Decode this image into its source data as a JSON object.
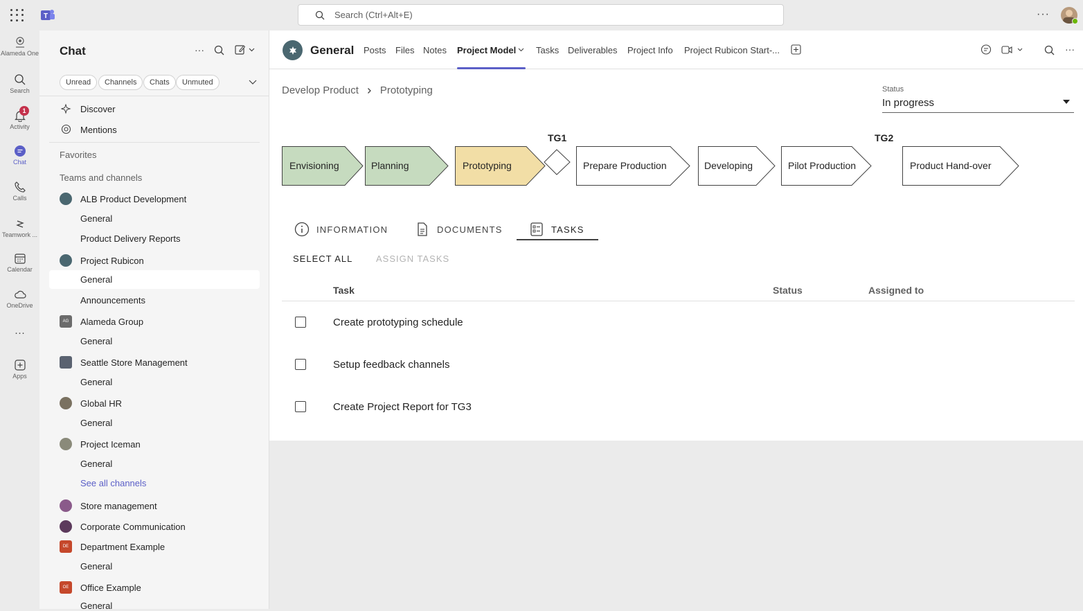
{
  "topbar": {
    "search_placeholder": "Search (Ctrl+Alt+E)",
    "more": "···"
  },
  "rail": [
    {
      "label": "Alameda One",
      "icon": "org-icon"
    },
    {
      "label": "Search",
      "icon": "search-icon"
    },
    {
      "label": "Activity",
      "icon": "bell-icon",
      "badge": "1"
    },
    {
      "label": "Chat",
      "icon": "chat-icon",
      "active": true
    },
    {
      "label": "Calls",
      "icon": "phone-icon"
    },
    {
      "label": "Teamwork ...",
      "icon": "teamwork-icon"
    },
    {
      "label": "Calendar",
      "icon": "calendar-icon"
    },
    {
      "label": "OneDrive",
      "icon": "cloud-icon"
    },
    {
      "label": "···",
      "icon": "more-icon"
    },
    {
      "label": "Apps",
      "icon": "apps-icon"
    }
  ],
  "sidebar": {
    "title": "Chat",
    "filters": [
      "Unread",
      "Channels",
      "Chats",
      "Unmuted"
    ],
    "discover": "Discover",
    "mentions": "Mentions",
    "favorites": "Favorites",
    "teams_heading": "Teams and channels",
    "teams": [
      {
        "name": "ALB Product Development",
        "channels": [
          "General",
          "Product Delivery Reports"
        ],
        "color": "#4a6770"
      },
      {
        "name": "Project Rubicon",
        "channels": [
          "General",
          "Announcements"
        ],
        "color": "#4a6770"
      },
      {
        "name": "Alameda Group",
        "channels": [
          "General"
        ],
        "color": "#6b6b6b",
        "initials": "AG"
      },
      {
        "name": "Seattle Store Management",
        "channels": [
          "General"
        ],
        "color": "#5a6270"
      },
      {
        "name": "Global HR",
        "channels": [
          "General"
        ],
        "color": "#7a7160"
      },
      {
        "name": "Project Iceman",
        "channels": [
          "General"
        ],
        "color": "#8a8a7a"
      }
    ],
    "see_all": "See all channels",
    "more_teams": [
      {
        "name": "Store management",
        "color": "#8a5a8a"
      },
      {
        "name": "Corporate Communication",
        "color": "#5c3a5c"
      },
      {
        "name": "Department Example",
        "color": "#c5482b",
        "initials": "DE",
        "channel": "General"
      },
      {
        "name": "Office Example",
        "color": "#c5482b",
        "initials": "OE",
        "channel": "General"
      }
    ]
  },
  "header": {
    "channel": "General",
    "tabs": [
      "Posts",
      "Files",
      "Notes",
      "Project Model",
      "Tasks",
      "Deliverables",
      "Project Info",
      "Project Rubicon Start-..."
    ],
    "active_tab": "Project Model"
  },
  "content": {
    "breadcrumb": [
      "Develop Product",
      "Prototyping"
    ],
    "status_label": "Status",
    "status_value": "In progress",
    "gates": [
      "TG1",
      "TG2"
    ],
    "phases": [
      {
        "label": "Envisioning",
        "state": "done",
        "color": "#c6dbbf"
      },
      {
        "label": "Planning",
        "state": "done",
        "color": "#c6dbbf"
      },
      {
        "label": "Prototyping",
        "state": "current",
        "color": "#f2dea6"
      },
      {
        "label": "Prepare Production",
        "state": "future",
        "color": "#ffffff"
      },
      {
        "label": "Developing",
        "state": "future",
        "color": "#ffffff"
      },
      {
        "label": "Pilot Production",
        "state": "future",
        "color": "#ffffff"
      },
      {
        "label": "Product Hand-over",
        "state": "future",
        "color": "#ffffff"
      }
    ],
    "panel_tabs": [
      "INFORMATION",
      "DOCUMENTS",
      "TASKS"
    ],
    "active_panel_tab": "TASKS",
    "select_all": "SELECT ALL",
    "assign_tasks": "ASSIGN TASKS",
    "columns": [
      "Task",
      "Status",
      "Assigned to"
    ],
    "tasks": [
      "Create prototyping schedule",
      "Setup feedback channels",
      "Create Project Report for TG3"
    ]
  }
}
